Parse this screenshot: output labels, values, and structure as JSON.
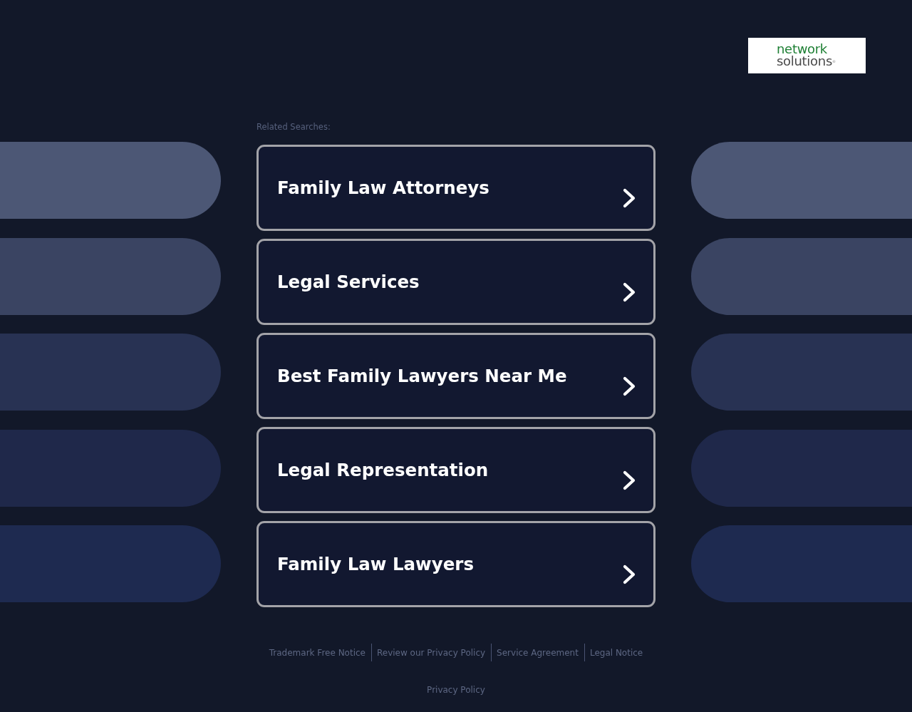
{
  "logo": {
    "lines": [
      "network",
      "solutions$^{®}$"
    ]
  },
  "related_searches": {
    "label": "Related Searches:",
    "items": [
      "Family Law Attorneys",
      "Legal Services",
      "Best Family Lawyers Near Me",
      "Legal Representation",
      "Family Law Lawyers"
    ]
  },
  "footer": {
    "links": [
      "Trademark Free Notice",
      "Review our Privacy Policy",
      "Service Agreement",
      "Legal Notice"
    ],
    "privacy_link": "Privacy Policy"
  }
}
